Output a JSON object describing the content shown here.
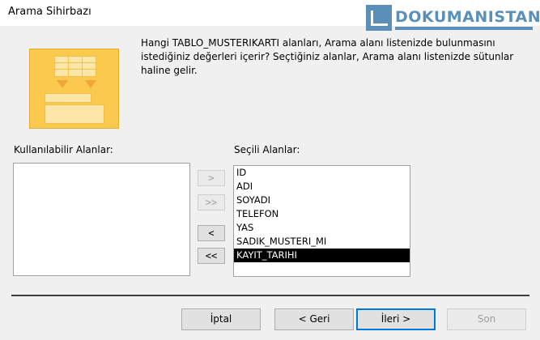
{
  "window": {
    "title": "Arama Sihirbazı"
  },
  "watermark": {
    "text": "DOKUMANISTAN"
  },
  "description": "Hangi TABLO_MUSTERIKARTI alanları, Arama alanı listenizde bulunmasını istediğiniz değerleri içerir? Seçtiğiniz alanlar, Arama alanı listenizde sütunlar haline gelir.",
  "available": {
    "label": "Kullanılabilir Alanlar:",
    "items": []
  },
  "selected": {
    "label": "Seçili Alanlar:",
    "items": [
      "ID",
      "ADI",
      "SOYADI",
      "TELEFON",
      "YAS",
      "SADIK_MUSTERI_MI",
      "KAYIT_TARIHI"
    ],
    "selected_item": "KAYIT_TARIHI"
  },
  "move_buttons": {
    "add_one": ">",
    "add_all": ">>",
    "remove_one": "<",
    "remove_all": "<<"
  },
  "footer": {
    "cancel": "İptal",
    "back": "< Geri",
    "next": "İleri >",
    "finish": "Son"
  }
}
